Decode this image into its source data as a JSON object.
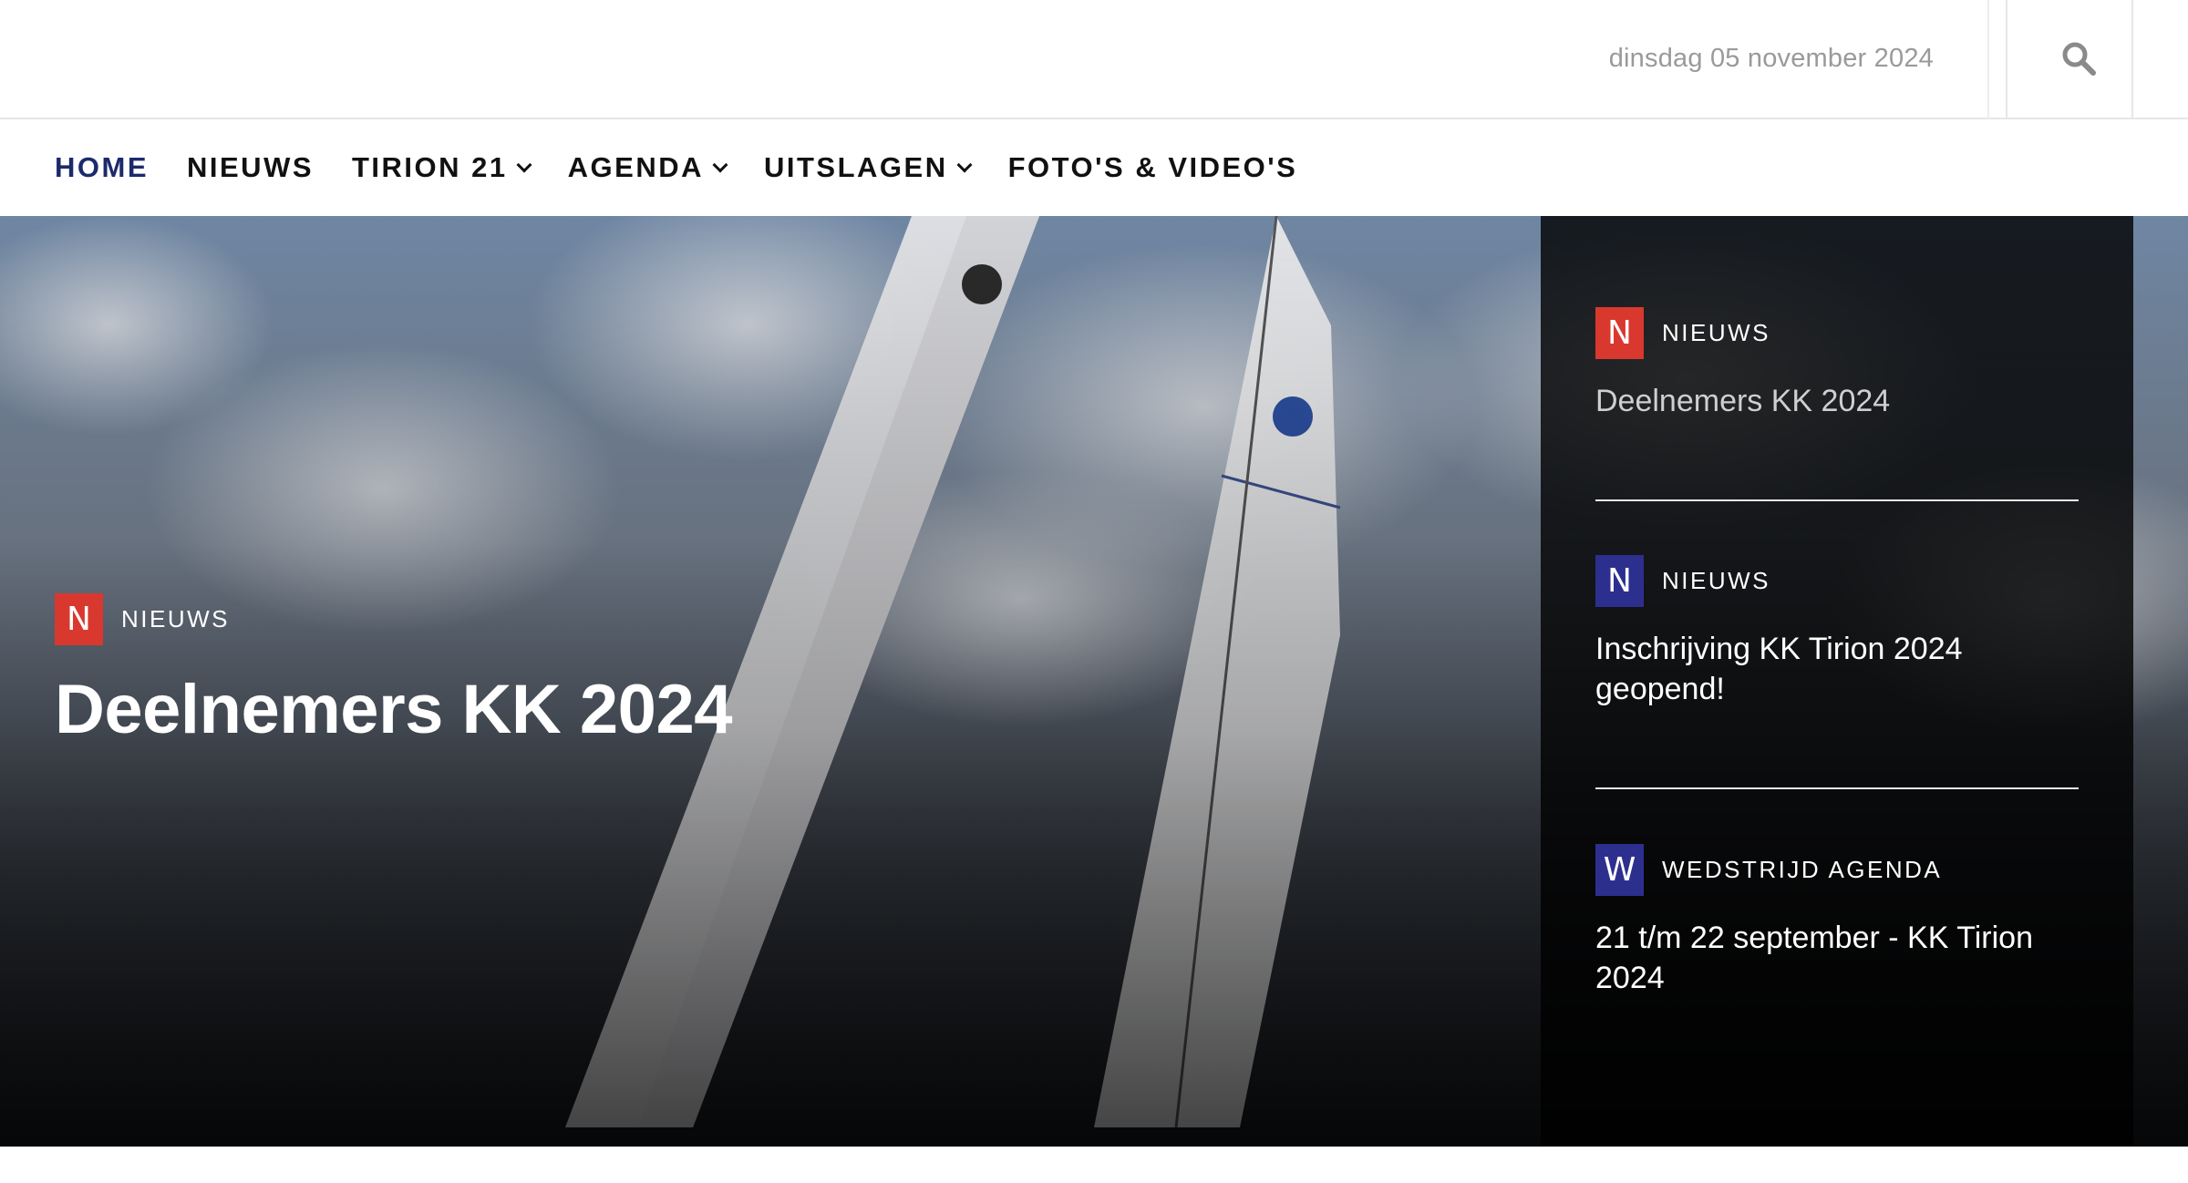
{
  "header": {
    "date": "dinsdag 05 november 2024",
    "search_icon": "search-icon"
  },
  "nav": {
    "items": [
      {
        "label": "HOME",
        "active": true,
        "dropdown": false
      },
      {
        "label": "NIEUWS",
        "active": false,
        "dropdown": false
      },
      {
        "label": "TIRION 21",
        "active": false,
        "dropdown": true
      },
      {
        "label": "AGENDA",
        "active": false,
        "dropdown": true
      },
      {
        "label": "UITSLAGEN",
        "active": false,
        "dropdown": true
      },
      {
        "label": "FOTO'S & VIDEO'S",
        "active": false,
        "dropdown": false
      }
    ]
  },
  "hero": {
    "badge": "N",
    "category": "NIEUWS",
    "title": "Deelnemers KK 2024"
  },
  "sidebar": {
    "items": [
      {
        "badge": "N",
        "badge_color": "#d9382f",
        "category": "NIEUWS",
        "title": "Deelnemers KK 2024"
      },
      {
        "badge": "N",
        "badge_color": "#2d2f8f",
        "category": "NIEUWS",
        "title": "Inschrijving KK Tirion 2024 geopend!"
      },
      {
        "badge": "W",
        "badge_color": "#2d2f8f",
        "category": "WEDSTRIJD AGENDA",
        "title": "21 t/m 22 september - KK Tirion 2024"
      }
    ]
  },
  "colors": {
    "accent_nav": "#1c2a6b",
    "badge_red": "#d9382f",
    "badge_blue": "#2d2f8f"
  }
}
